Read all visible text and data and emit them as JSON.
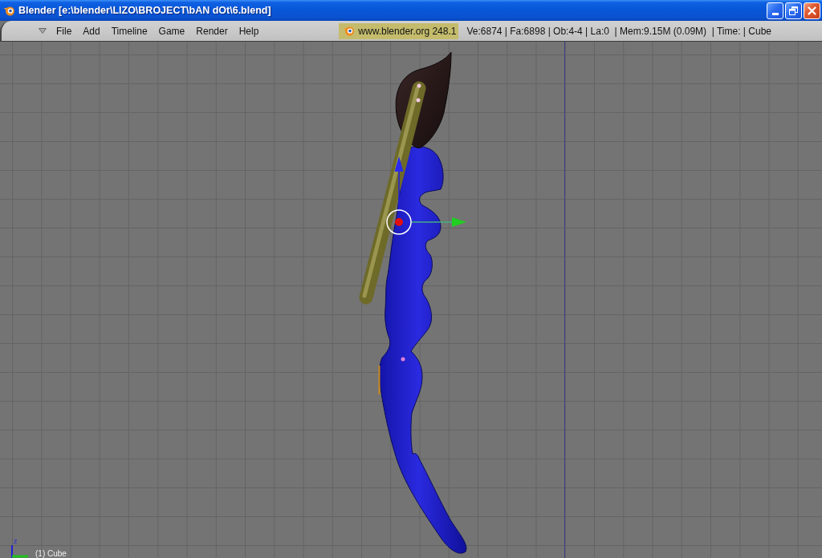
{
  "window": {
    "title": "Blender [e:\\blender\\LIZO\\BROJECT\\bAN dOt\\6.blend]"
  },
  "header": {
    "menu_items": [
      "File",
      "Add",
      "Timeline",
      "Game",
      "Render",
      "Help"
    ],
    "version_badge": "www.blender.org 248.1",
    "stats": "Ve:6874 | Fa:6898 | Ob:4-4 | La:0  | Mem:9.15M (0.09M)  | Time: | Cube"
  },
  "viewport": {
    "axis_label": "z",
    "object_label": "(1) Cube"
  }
}
